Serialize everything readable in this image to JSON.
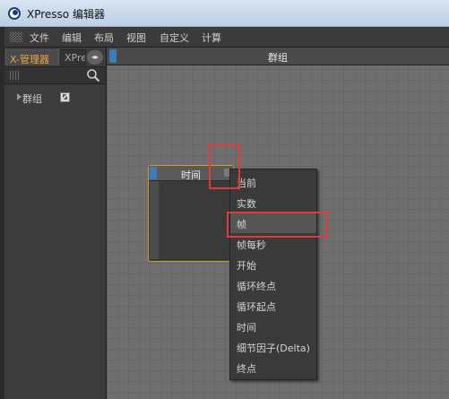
{
  "window": {
    "title": "XPresso 编辑器"
  },
  "menubar": {
    "items": [
      "文件",
      "编辑",
      "布局",
      "视图",
      "自定义",
      "计算"
    ]
  },
  "left_panel": {
    "tabs": [
      "X-管理器",
      "XPresso"
    ],
    "tree": [
      {
        "label": "群组"
      }
    ]
  },
  "editor": {
    "title": "群组"
  },
  "node": {
    "title": "时间"
  },
  "context_menu": {
    "items": [
      "当前",
      "实数",
      "帧",
      "帧每秒",
      "开始",
      "循环终点",
      "循环起点",
      "时间",
      "细节因子(Delta)",
      "终点"
    ],
    "selected_index": 2
  },
  "colors": {
    "accent_blue": "#3d7bbf",
    "node_border": "#d89a2a",
    "highlight_red": "#e3393a",
    "active_tab_text": "#f0a640"
  }
}
